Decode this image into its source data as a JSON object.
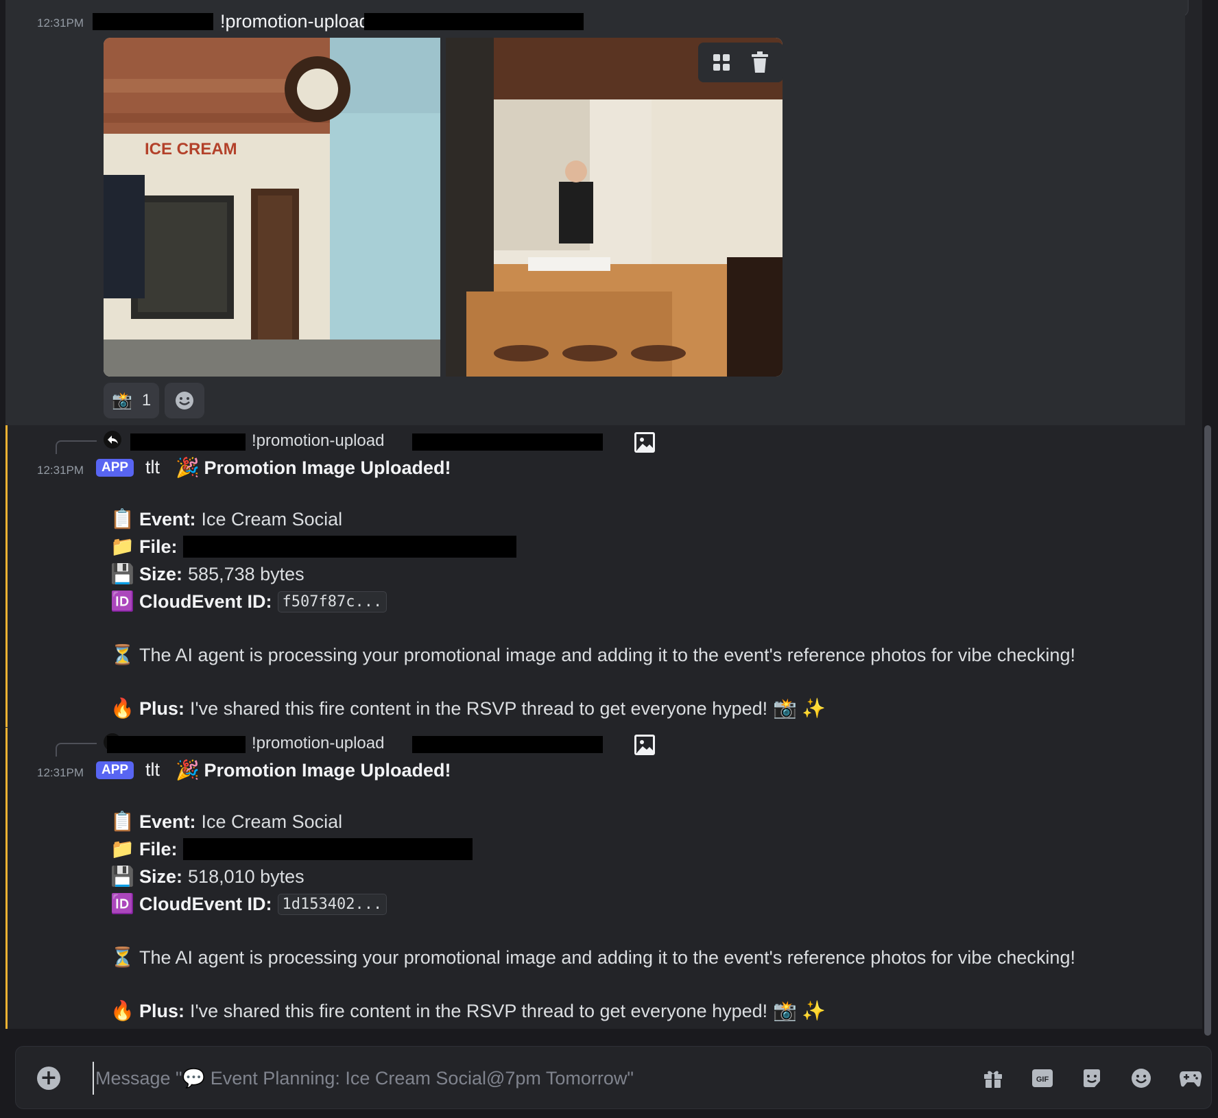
{
  "message1": {
    "timestamp": "12:31PM",
    "command": "!promotion-upload",
    "reaction": {
      "emoji": "📸",
      "count": "1"
    }
  },
  "bot_messages": [
    {
      "reply_command": "!promotion-upload",
      "timestamp": "12:31PM",
      "badge": "APP",
      "author": "tlt",
      "headline_emoji": "🎉",
      "headline": "Promotion Image Uploaded!",
      "event_label": "Event:",
      "event_value": "Ice Cream Social",
      "file_label": "File:",
      "size_label": "Size:",
      "size_value": "585,738 bytes",
      "id_label": "CloudEvent ID:",
      "id_value": "f507f87c...",
      "processing": "The AI agent is processing your promotional image and adding it to the event's reference photos for vibe checking!",
      "plus_label": "Plus:",
      "plus_text": "I've shared this fire content in the RSVP thread to get everyone hyped!"
    },
    {
      "reply_command": "!promotion-upload",
      "timestamp": "12:31PM",
      "badge": "APP",
      "author": "tlt",
      "headline_emoji": "🎉",
      "headline": "Promotion Image Uploaded!",
      "event_label": "Event:",
      "event_value": "Ice Cream Social",
      "file_label": "File:",
      "size_label": "Size:",
      "size_value": "518,010 bytes",
      "id_label": "CloudEvent ID:",
      "id_value": "1d153402...",
      "processing": "The AI agent is processing your promotional image and adding it to the event's reference photos for vibe checking!",
      "plus_label": "Plus:",
      "plus_text": "I've shared this fire content in the RSVP thread to get everyone hyped!"
    }
  ],
  "emojis": {
    "clipboard": "📋",
    "folder": "📁",
    "floppy": "💾",
    "id": "🆔",
    "hourglass": "⏳",
    "fire": "🔥",
    "camera": "📸",
    "sparkles": "✨"
  },
  "composer": {
    "placeholder": "Message \"💬 Event Planning: Ice Cream Social@7pm Tomorrow\""
  },
  "icons": [
    "plus-circle-icon",
    "gift-icon",
    "gif-icon",
    "sticker-icon",
    "emoji-icon",
    "gamepad-icon",
    "reply-icon",
    "image-icon",
    "apps-icon",
    "trash-icon"
  ],
  "colors": {
    "accent": "#5865f2",
    "highlight_border": "#f0b232",
    "background": "#232428"
  }
}
